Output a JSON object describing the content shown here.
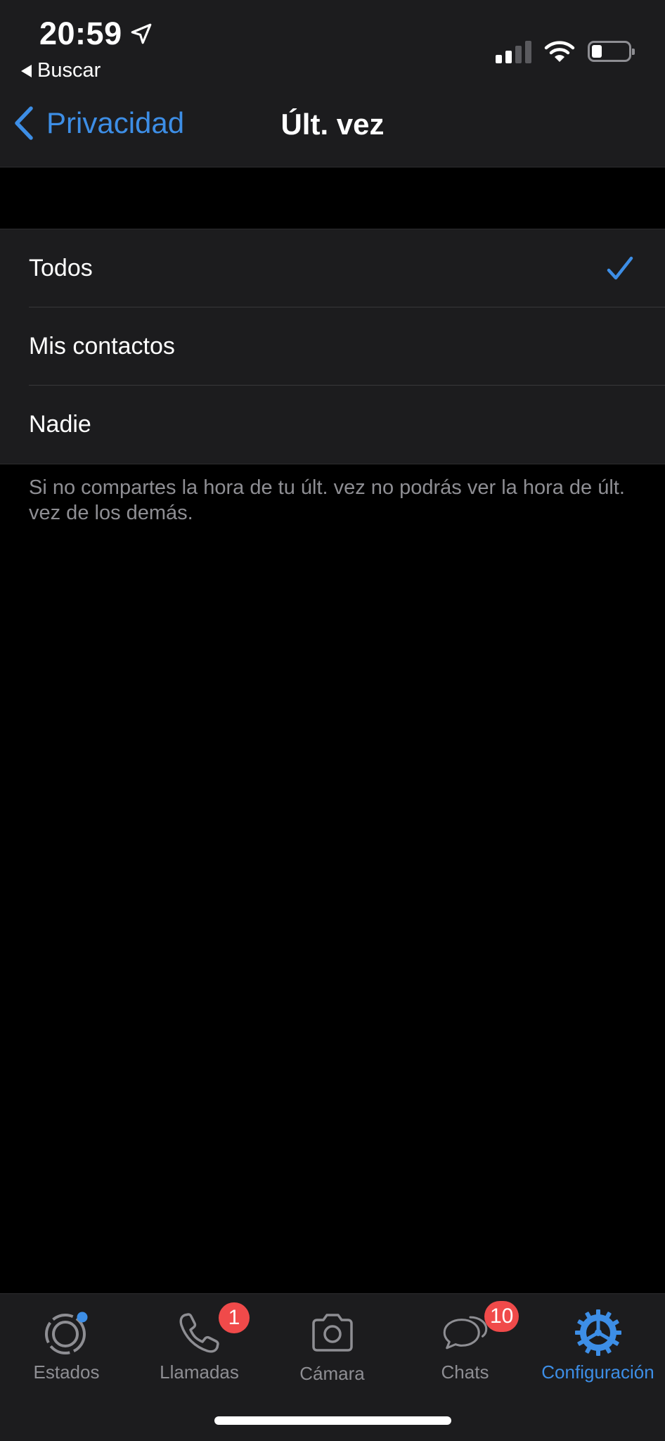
{
  "status_bar": {
    "time": "20:59",
    "back_app_label": "Buscar"
  },
  "nav": {
    "back_label": "Privacidad",
    "title": "Últ. vez"
  },
  "options": [
    {
      "label": "Todos",
      "selected": true
    },
    {
      "label": "Mis contactos",
      "selected": false
    },
    {
      "label": "Nadie",
      "selected": false
    }
  ],
  "footnote": "Si no compartes la hora de tu últ. vez no podrás ver la hora de últ. vez de los demás.",
  "tabs": [
    {
      "label": "Estados",
      "icon": "status-icon",
      "badge": null,
      "active": false
    },
    {
      "label": "Llamadas",
      "icon": "phone-icon",
      "badge": "1",
      "active": false
    },
    {
      "label": "Cámara",
      "icon": "camera-icon",
      "badge": null,
      "active": false
    },
    {
      "label": "Chats",
      "icon": "chat-bubbles-icon",
      "badge": "10",
      "active": false
    },
    {
      "label": "Configuración",
      "icon": "gear-icon",
      "badge": null,
      "active": true
    }
  ],
  "colors": {
    "accent": "#3d8ee6",
    "badge": "#f04a4a",
    "background": "#000000",
    "surface": "#1c1c1e",
    "secondary_text": "#8e8e93"
  }
}
